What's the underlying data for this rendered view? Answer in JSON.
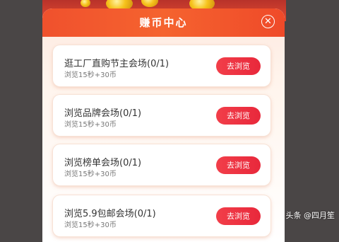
{
  "modal": {
    "title": "赚币中心",
    "close_icon": "close-icon"
  },
  "tasks": [
    {
      "title": "逛工厂直购节主会场(0/1)",
      "subtitle": "浏览15秒+30币",
      "button": "去浏览"
    },
    {
      "title": "浏览品牌会场(0/1)",
      "subtitle": "浏览15秒+30币",
      "button": "去浏览"
    },
    {
      "title": "浏览榜单会场(0/1)",
      "subtitle": "浏览15秒+30币",
      "button": "去浏览"
    },
    {
      "title": "浏览5.9包邮会场(0/1)",
      "subtitle": "浏览15秒+30币",
      "button": "去浏览"
    }
  ],
  "watermark": "头条 @四月笙",
  "colors": {
    "header": "#f0512d",
    "button": "#e8283b",
    "backdrop": "#4a4646"
  }
}
